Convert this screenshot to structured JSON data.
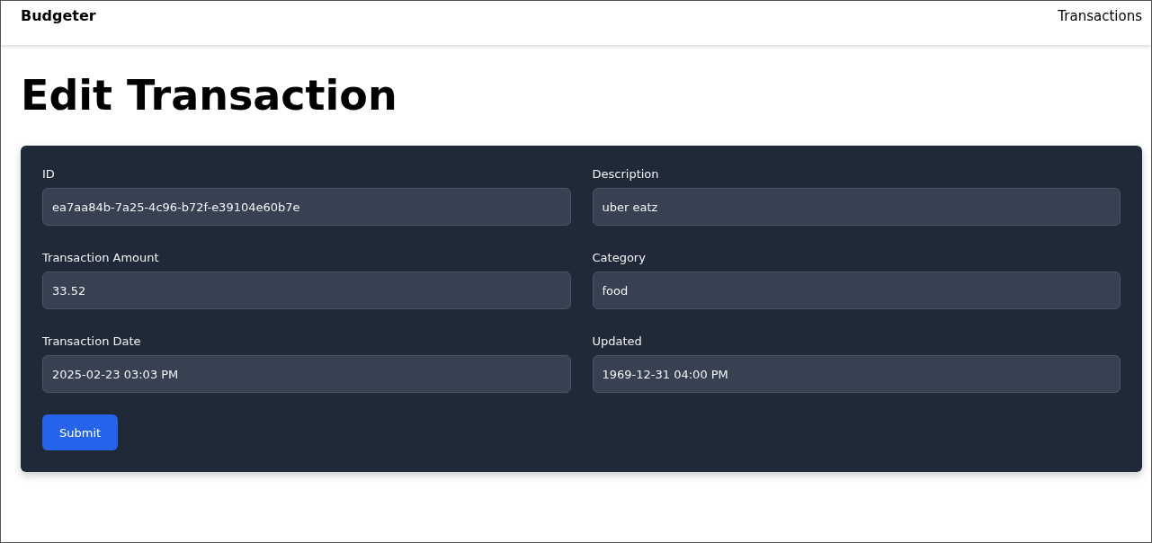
{
  "navbar": {
    "brand": "Budgeter",
    "links": [
      "Transactions"
    ]
  },
  "page": {
    "title": "Edit Transaction"
  },
  "form": {
    "fields": [
      {
        "label": "ID",
        "value": "ea7aa84b-7a25-4c96-b72f-e39104e60b7e"
      },
      {
        "label": "Description",
        "value": "uber eatz"
      },
      {
        "label": "Transaction Amount",
        "value": "33.52"
      },
      {
        "label": "Category",
        "value": "food"
      },
      {
        "label": "Transaction Date",
        "value": "2025-02-23 03:03 PM"
      },
      {
        "label": "Updated",
        "value": "1969-12-31 04:00 PM"
      }
    ],
    "submit": "Submit"
  }
}
